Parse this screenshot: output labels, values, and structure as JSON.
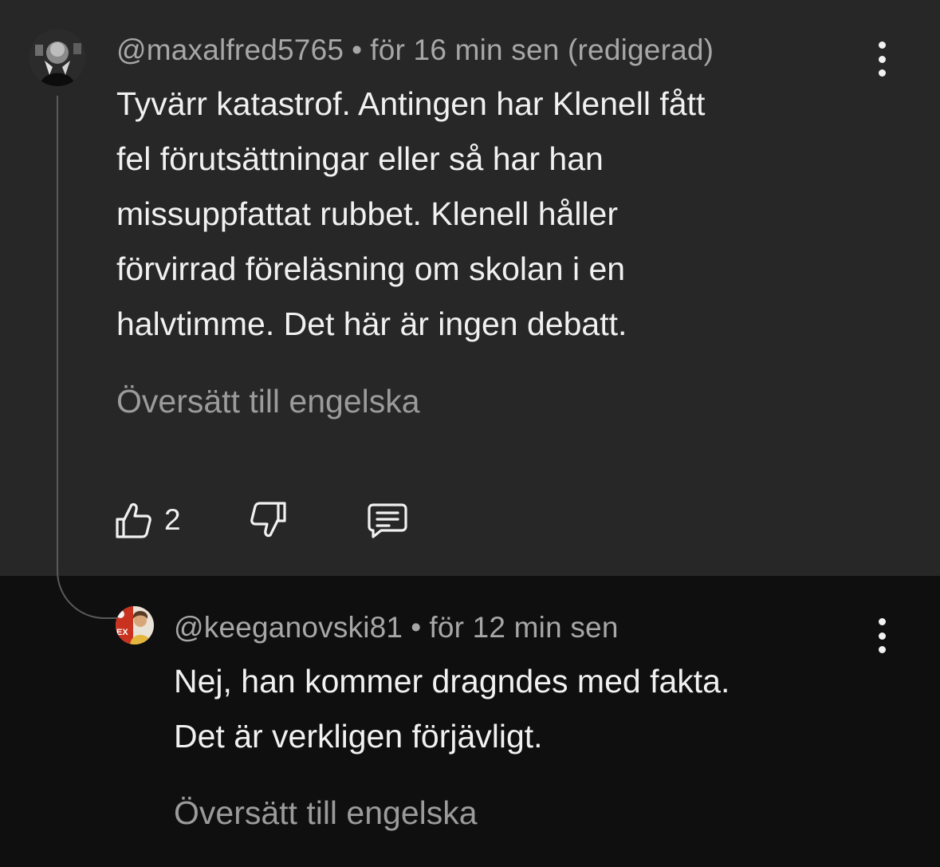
{
  "main_comment": {
    "username": "@maxalfred5765",
    "separator": "•",
    "timestamp": "för 16 min sen (redigerad)",
    "text": "Tyvärr katastrof. Antingen har Klenell fått\nfel förutsättningar eller så har han\nmissuppfattat rubbet. Klenell håller\nförvirrad föreläsning om skolan i en\nhalvtimme. Det här är ingen debatt.",
    "translate_label": "Översätt till engelska",
    "like_count": "2",
    "icons": {
      "avatar": "user-avatar",
      "like": "thumbs-up-icon",
      "dislike": "thumbs-down-icon",
      "reply": "comment-icon",
      "menu": "more-vertical-icon"
    }
  },
  "reply_comment": {
    "username": "@keeganovski81",
    "separator": "•",
    "timestamp": "för 12 min sen",
    "text": "Nej, han kommer dragndes med fakta.\nDet är verkligen förjävligt.",
    "translate_label": "Översätt till engelska",
    "icons": {
      "avatar": "user-avatar",
      "menu": "more-vertical-icon"
    }
  },
  "colors": {
    "main_bg": "#272727",
    "page_bg": "#0f0f0f",
    "text_primary": "#f1f1f1",
    "text_secondary": "#a7a7a7",
    "thread_line": "#5a5a5a"
  }
}
